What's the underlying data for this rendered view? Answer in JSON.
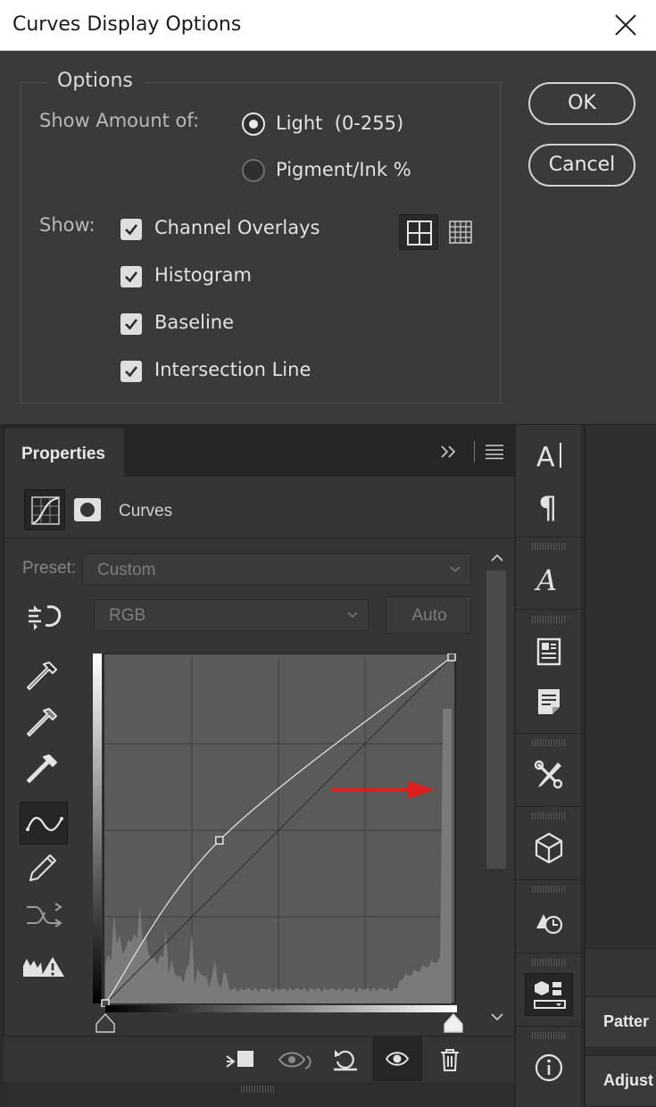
{
  "dialog": {
    "title": "Curves Display Options",
    "options_legend": "Options",
    "show_amount_label": "Show Amount of:",
    "radio_light": "Light  (0-255)",
    "radio_pigment": "Pigment/Ink %",
    "show_label": "Show:",
    "checks": [
      "Channel Overlays",
      "Histogram",
      "Baseline",
      "Intersection Line"
    ],
    "ok_label": "OK",
    "cancel_label": "Cancel"
  },
  "properties": {
    "tab_title": "Properties",
    "adjustment_name": "Curves",
    "preset_label": "Preset:",
    "preset_value": "Custom",
    "channel_value": "RGB",
    "auto_label": "Auto"
  },
  "right_panels": {
    "patterns_label": "Patter",
    "adjustments_label": "Adjust"
  },
  "colors": {
    "annotation_arrow": "#e01e1e",
    "dialog_bg": "#3a3a3a",
    "panel_bg": "#353535"
  },
  "curve": {
    "points": [
      [
        0,
        0
      ],
      [
        84,
        120
      ],
      [
        255,
        255
      ]
    ]
  }
}
